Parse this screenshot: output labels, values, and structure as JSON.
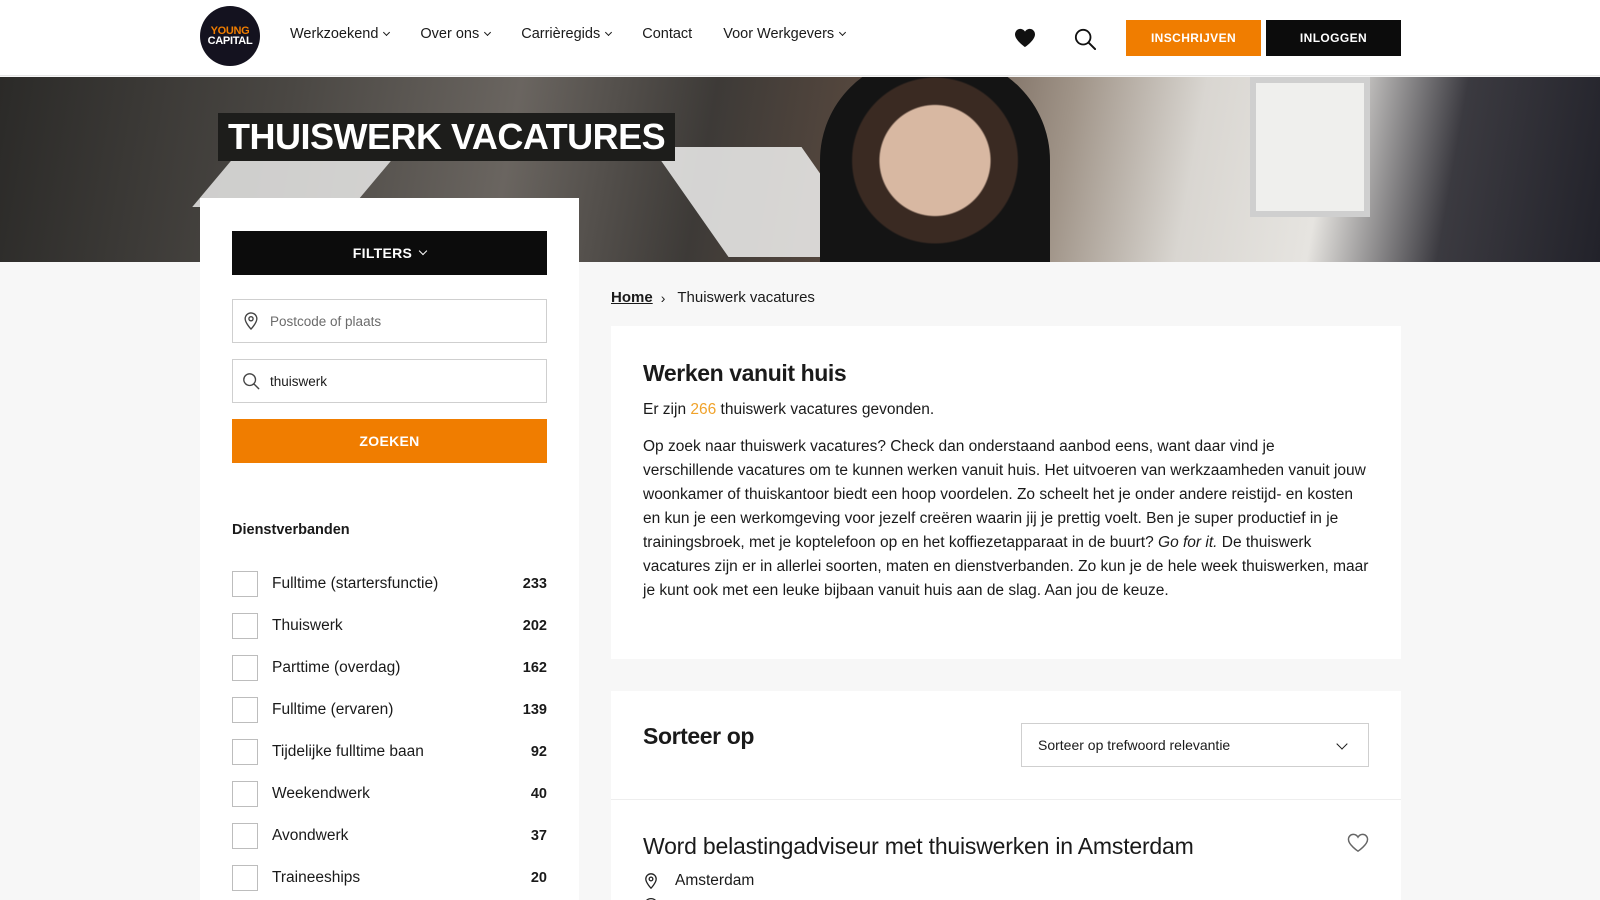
{
  "brand": {
    "logo_line1": "YOUNG",
    "logo_line2": "CAPITAL",
    "accent": "#f07d00",
    "dark": "#0c0c0c"
  },
  "nav": {
    "items": [
      {
        "label": "Werkzoekend",
        "dropdown": true
      },
      {
        "label": "Over ons",
        "dropdown": true
      },
      {
        "label": "Carrièregids",
        "dropdown": true
      },
      {
        "label": "Contact",
        "dropdown": false
      },
      {
        "label": "Voor Werkgevers",
        "dropdown": true
      }
    ],
    "register_label": "INSCHRIJVEN",
    "login_label": "INLOGGEN",
    "icons": [
      "heart-icon",
      "search-icon"
    ]
  },
  "hero": {
    "title": "THUISWERK VACATURES"
  },
  "sidebar": {
    "filters_label": "FILTERS",
    "location_placeholder": "Postcode of plaats",
    "location_value": "",
    "keyword_value": "thuiswerk",
    "search_label": "ZOEKEN",
    "group_title": "Dienstverbanden",
    "options": [
      {
        "label": "Fulltime (startersfunctie)",
        "count": "233",
        "checked": false
      },
      {
        "label": "Thuiswerk",
        "count": "202",
        "checked": false
      },
      {
        "label": "Parttime (overdag)",
        "count": "162",
        "checked": false
      },
      {
        "label": "Fulltime (ervaren)",
        "count": "139",
        "checked": false
      },
      {
        "label": "Tijdelijke fulltime baan",
        "count": "92",
        "checked": false
      },
      {
        "label": "Weekendwerk",
        "count": "40",
        "checked": false
      },
      {
        "label": "Avondwerk",
        "count": "37",
        "checked": false
      },
      {
        "label": "Traineeships",
        "count": "20",
        "checked": false
      }
    ]
  },
  "breadcrumb": {
    "home": "Home",
    "separator": "›",
    "current": "Thuiswerk vacatures"
  },
  "intro": {
    "title": "Werken vanuit huis",
    "count_prefix": "Er zijn ",
    "count": "266",
    "count_suffix": " thuiswerk vacatures gevonden.",
    "desc_part1": "Op zoek naar thuiswerk vacatures? Check dan onderstaand aanbod eens, want daar vind je verschillende vacatures om te kunnen werken vanuit huis. Het uitvoeren van werkzaamheden vanuit jouw woonkamer of thuiskantoor biedt een hoop voordelen. Zo scheelt het je onder andere reistijd- en kosten en kun je een werkomgeving voor jezelf creëren waarin jij je prettig voelt. Ben je super productief in je trainingsbroek, met je koptelefoon op en het koffiezetapparaat in de buurt? ",
    "desc_em": "Go for it.",
    "desc_part2": " De thuiswerk vacatures zijn er in allerlei soorten, maten en dienstverbanden. Zo kun je de hele week thuiswerken, maar je kunt ook met een leuke bijbaan vanuit huis aan de slag. Aan jou de keuze."
  },
  "sort": {
    "title": "Sorteer op",
    "selected": "Sorteer op trefwoord relevantie"
  },
  "jobs": [
    {
      "title": "Word belastingadviseur met thuiswerken in Amsterdam",
      "location": "Amsterdam"
    }
  ]
}
